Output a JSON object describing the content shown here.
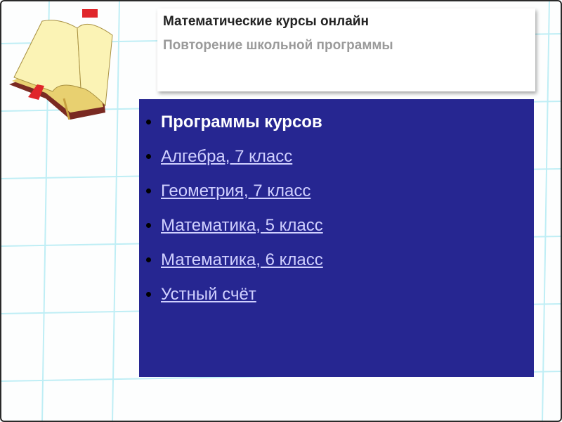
{
  "header": {
    "title": "Математические курсы онлайн",
    "subtitle": "Повторение школьной программы"
  },
  "content": {
    "heading": "Программы курсов",
    "links": [
      {
        "label": "Алгебра, 7 класс"
      },
      {
        "label": "Геометрия, 7 класс"
      },
      {
        "label": "Математика, 5 класс"
      },
      {
        "label": "Математика, 6 класс"
      },
      {
        "label": "Устный счёт"
      }
    ]
  },
  "colors": {
    "panel": "#262691",
    "link": "#d0d0ff",
    "grid": "#bfeef5"
  }
}
